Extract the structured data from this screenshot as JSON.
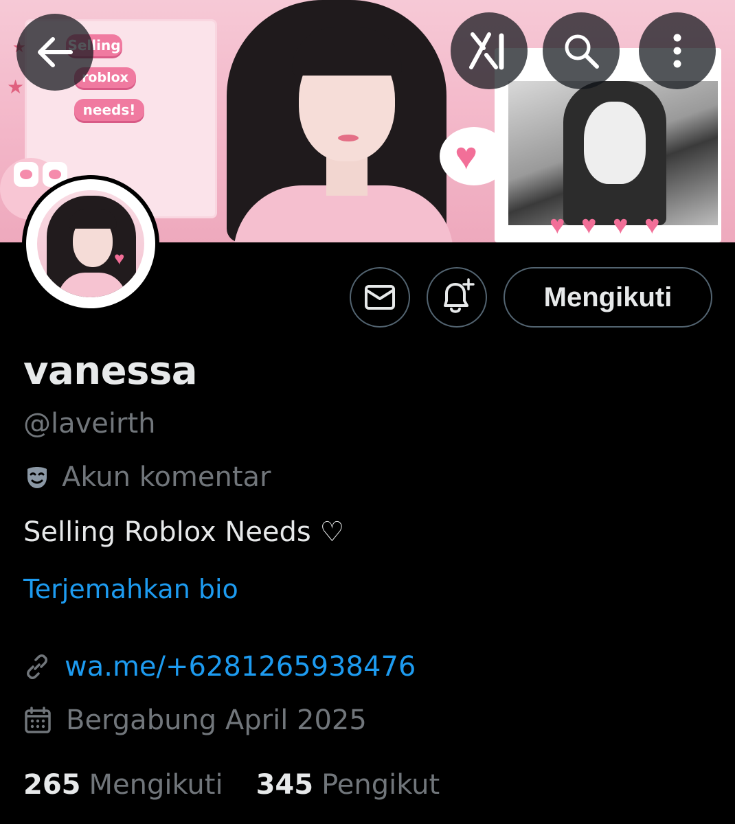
{
  "banner": {
    "stickers": [
      "Selling",
      "roblox",
      "needs!"
    ],
    "colors": {
      "pink": "#f3b6c8",
      "accent_pink": "#f07aa0"
    }
  },
  "top_nav": {
    "back_icon": "arrow-left-icon",
    "grok_icon": "grok-icon",
    "search_icon": "search-icon",
    "more_icon": "more-vertical-icon"
  },
  "actions": {
    "message_icon": "envelope-icon",
    "notify_icon": "bell-plus-icon",
    "follow_label": "Mengikuti"
  },
  "profile": {
    "display_name": "vanessa",
    "handle": "@laveirth",
    "account_label": "Akun komentar",
    "account_label_icon": "theater-mask-icon",
    "bio": "Selling Roblox Needs ♡",
    "translate_bio": "Terjemahkan bio",
    "link": "wa.me/+6281265938476",
    "joined": "Bergabung April 2025"
  },
  "stats": {
    "following_count": "265",
    "following_label": "Mengikuti",
    "followers_count": "345",
    "followers_label": "Pengikut"
  },
  "colors": {
    "background": "#000000",
    "text_primary": "#e7e9ea",
    "text_secondary": "#71767b",
    "link": "#1d9bf0",
    "border": "#536471"
  }
}
